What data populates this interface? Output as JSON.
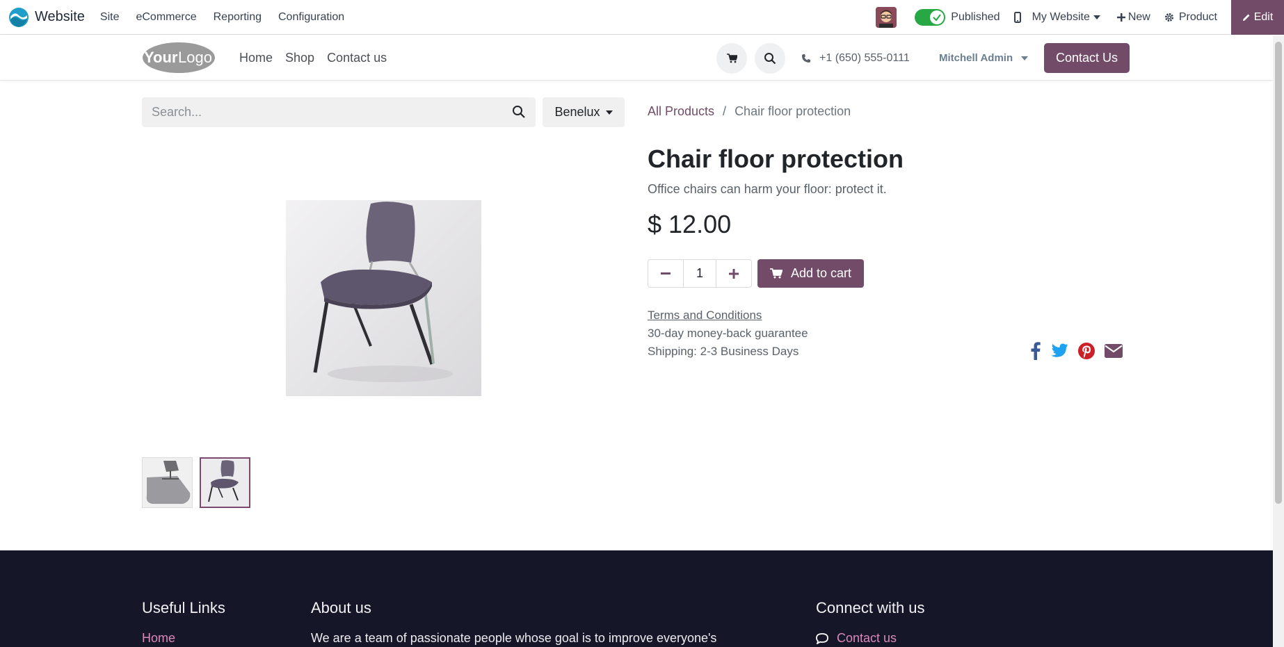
{
  "adminbar": {
    "app_name": "Website",
    "menu": [
      "Site",
      "eCommerce",
      "Reporting",
      "Configuration"
    ],
    "published_label": "Published",
    "published": true,
    "website_selector": "My Website",
    "new_label": "New",
    "product_label": "Product",
    "edit_label": "Edit"
  },
  "header": {
    "logo_text_bold": "Your",
    "logo_text": "Logo",
    "nav": [
      "Home",
      "Shop",
      "Contact us"
    ],
    "phone": "+1 (650) 555-0111",
    "user": "Mitchell Admin",
    "contact_button": "Contact Us"
  },
  "shop": {
    "search_placeholder": "Search...",
    "pricelist": "Benelux"
  },
  "product": {
    "breadcrumb": [
      "All Products",
      "Chair floor protection"
    ],
    "breadcrumb_separator": "/",
    "title": "Chair floor protection",
    "description": "Office chairs can harm your floor: protect it.",
    "price": "$ 12.00",
    "quantity": "1",
    "add_to_cart": "Add to cart",
    "terms": "Terms and Conditions",
    "guarantee": "30-day money-back guarantee",
    "shipping": "Shipping: 2-3 Business Days",
    "thumbnails": [
      "floor-mat-image",
      "chair-image"
    ],
    "active_thumbnail": 1
  },
  "share_icons": [
    "facebook-icon",
    "twitter-icon",
    "pinterest-icon",
    "envelope-icon"
  ],
  "footer": {
    "useful_links_title": "Useful Links",
    "useful_links_first": "Home",
    "about_title": "About us",
    "about_text": "We are a team of passionate people whose goal is to improve everyone's",
    "connect_title": "Connect with us",
    "connect_first": "Contact us"
  },
  "colors": {
    "brand": "#714b67",
    "toggle_on": "#28a745",
    "footer_bg": "#161629",
    "footer_link": "#d98aba",
    "facebook": "#3b5998",
    "twitter": "#1da1f2",
    "pinterest": "#cb2027",
    "email": "#714b67"
  }
}
